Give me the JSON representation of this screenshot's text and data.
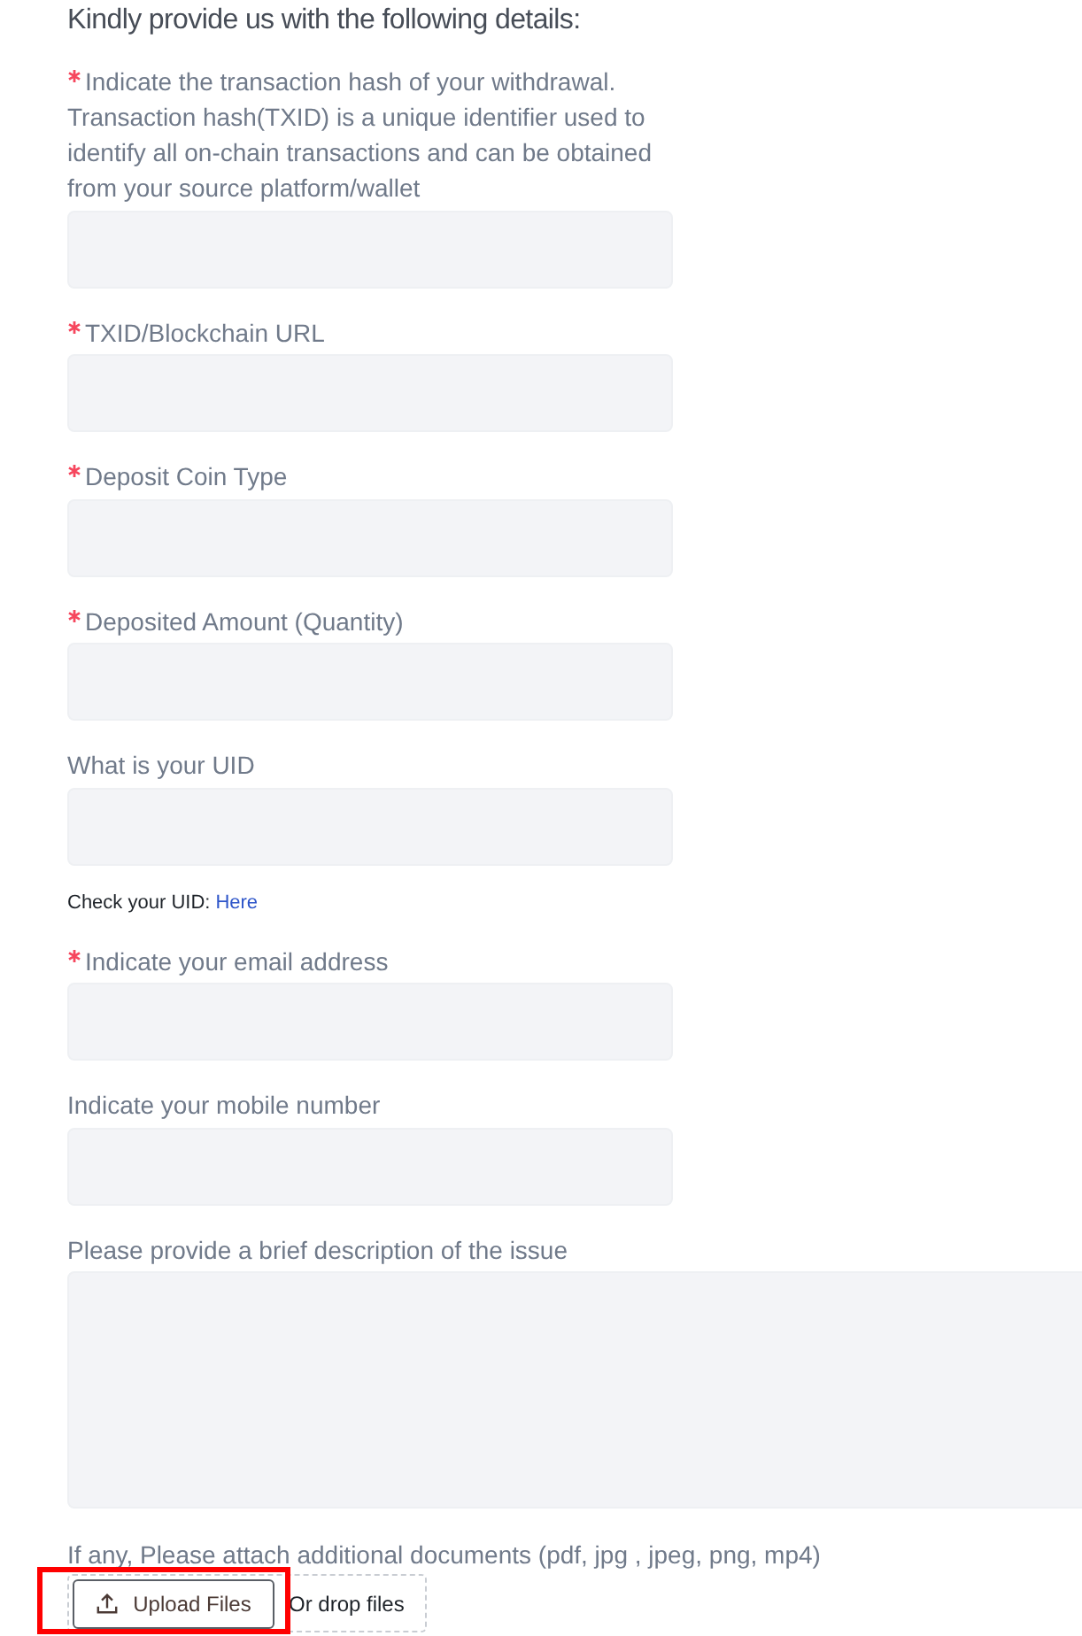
{
  "heading": "Kindly provide us with the following details:",
  "fields": [
    {
      "kind": "input",
      "required": true,
      "label": "Indicate the transaction hash of your withdrawal. Transaction hash(TXID) is a unique identifier used to identify all on-chain transactions and can be obtained from your source platform/wallet"
    },
    {
      "kind": "input",
      "required": true,
      "label": "TXID/Blockchain URL"
    },
    {
      "kind": "input",
      "required": true,
      "label": "Deposit Coin Type"
    },
    {
      "kind": "input",
      "required": true,
      "label": "Deposited Amount (Quantity)"
    },
    {
      "kind": "input",
      "required": false,
      "label": "What is your UID",
      "hint": {
        "text": "Check your UID:",
        "link": "Here"
      }
    },
    {
      "kind": "input",
      "required": true,
      "label": "Indicate your email address"
    },
    {
      "kind": "input",
      "required": false,
      "label": "Indicate your mobile number"
    },
    {
      "kind": "textarea",
      "required": false,
      "label": "Please provide a brief description of the issue"
    }
  ],
  "attachments": {
    "label": "If any, Please attach additional documents (pdf, jpg , jpeg, png, mp4)",
    "button": "Upload Files",
    "drop_text": "Or drop files",
    "highlighted": true
  }
}
